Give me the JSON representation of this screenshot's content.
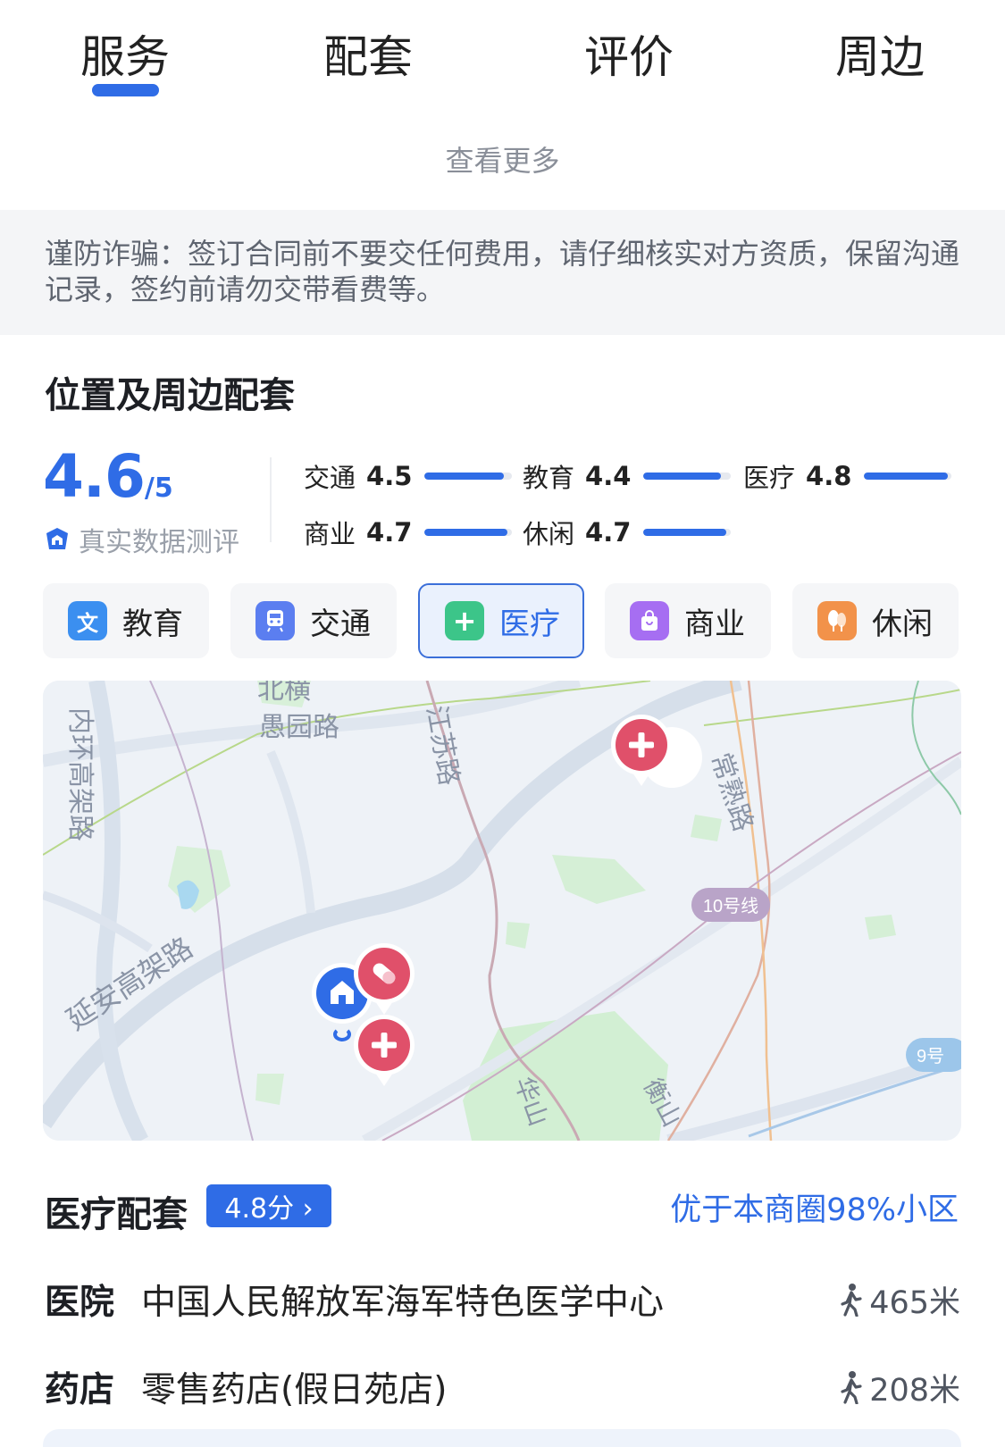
{
  "tabs": [
    {
      "label": "服务",
      "active": true
    },
    {
      "label": "配套",
      "active": false
    },
    {
      "label": "评价",
      "active": false
    },
    {
      "label": "周边",
      "active": false
    }
  ],
  "see_more": "查看更多",
  "warning": "谨防诈骗：签订合同前不要交任何费用，请仔细核实对方资质，保留沟通记录，签约前请勿交带看费等。",
  "section_title": "位置及周边配套",
  "score": {
    "value": "4.6",
    "denominator": "/5",
    "source_label": "真实数据测评"
  },
  "sub_scores": [
    {
      "label": "交通",
      "value": "4.5",
      "fraction": 0.9
    },
    {
      "label": "教育",
      "value": "4.4",
      "fraction": 0.88
    },
    {
      "label": "医疗",
      "value": "4.8",
      "fraction": 0.96
    },
    {
      "label": "商业",
      "value": "4.7",
      "fraction": 0.94
    },
    {
      "label": "休闲",
      "value": "4.7",
      "fraction": 0.94
    }
  ],
  "categories": [
    {
      "label": "教育",
      "icon": "book-icon",
      "glyph": "文",
      "color": "#3b8ff0",
      "active": false
    },
    {
      "label": "交通",
      "icon": "train-icon",
      "glyph": "",
      "color": "#5b7ef0",
      "active": false
    },
    {
      "label": "医疗",
      "icon": "medical-cross-icon",
      "glyph": "+",
      "color": "#3cc589",
      "active": true
    },
    {
      "label": "商业",
      "icon": "shopping-bag-icon",
      "glyph": "",
      "color": "#a66ef2",
      "active": false
    },
    {
      "label": "休闲",
      "icon": "leisure-icon",
      "glyph": "",
      "color": "#f2924a",
      "active": false
    }
  ],
  "map": {
    "labels": {
      "beiheng": "北横",
      "yuyuan": "愚园路",
      "jiangsu": "江苏路",
      "neihuan": "内环高架路",
      "changshu": "常熟路",
      "line10": "10号线",
      "yanan": "延安高架路",
      "huashan": "华山",
      "hengshan": "衡山",
      "line9": "9号"
    }
  },
  "medical": {
    "title": "医疗配套",
    "badge": "4.8分 ›",
    "better": "优于本商圈98%小区",
    "items": [
      {
        "type": "医院",
        "name": "中国人民解放军海军特色医学中心",
        "distance": "465米"
      },
      {
        "type": "药店",
        "name": "零售药店(假日苑店)",
        "distance": "208米"
      }
    ]
  },
  "colors": {
    "accent": "#2f6ce6",
    "hospital_pin": "#e0506a",
    "home_pin": "#2f6ce6"
  }
}
